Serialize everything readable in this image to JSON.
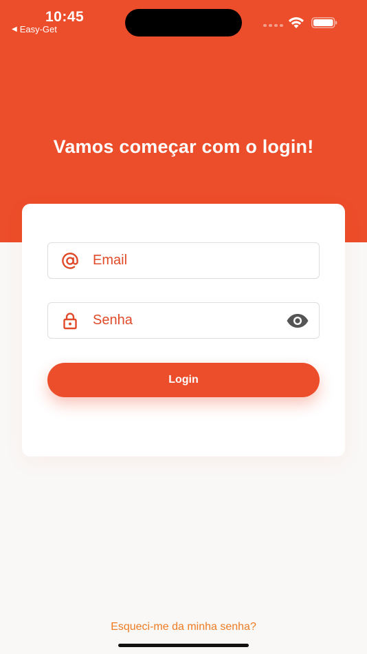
{
  "status_bar": {
    "time": "10:45",
    "back_label": "Easy-Get",
    "back_icon": "back-triangle-icon",
    "wifi_icon": "wifi-icon",
    "battery_icon": "battery-icon"
  },
  "header": {
    "title": "Vamos começar com o login!"
  },
  "form": {
    "email": {
      "icon": "at-sign-icon",
      "placeholder": "Email"
    },
    "password": {
      "icon": "lock-icon",
      "placeholder": "Senha",
      "toggle_icon": "eye-icon"
    },
    "login_label": "Login"
  },
  "footer": {
    "forgot_label": "Esqueci-me da minha senha?"
  },
  "colors": {
    "brand": "#ec4d2a",
    "accent_text": "#e04a28",
    "link": "#ee7b22",
    "background": "#f9f8f7"
  }
}
